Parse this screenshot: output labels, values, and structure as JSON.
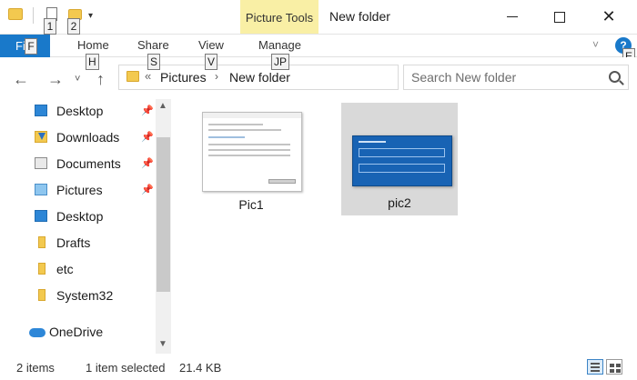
{
  "titlebar": {
    "context_tab": "Picture Tools",
    "title": "New folder",
    "qa_dropdown_icon": "chevron-down-icon",
    "buttons": {
      "minimize": "minimize-icon",
      "maximize": "maximize-icon",
      "close": "✕"
    }
  },
  "keytips": {
    "qa1": "1",
    "qa2": "2",
    "file": "F",
    "home": "H",
    "share": "S",
    "view": "V",
    "manage": "JP",
    "help": "E"
  },
  "ribbon": {
    "tabs": [
      {
        "label": "File"
      },
      {
        "label": "Home"
      },
      {
        "label": "Share"
      },
      {
        "label": "View"
      },
      {
        "label": "Manage"
      }
    ],
    "help": "?",
    "accent": "#1979ca"
  },
  "nav": {
    "back": "←",
    "forward": "→",
    "recent": "˅",
    "up": "↑",
    "address": {
      "overflow": "«",
      "crumbs": [
        "Pictures",
        "New folder"
      ],
      "separator": "›"
    },
    "refresh": "↻",
    "search_placeholder": "Search New folder"
  },
  "navpane": {
    "items": [
      {
        "label": "Desktop",
        "icon": "desktop-icon",
        "pinned": true
      },
      {
        "label": "Downloads",
        "icon": "downloads-icon",
        "pinned": true
      },
      {
        "label": "Documents",
        "icon": "documents-icon",
        "pinned": true
      },
      {
        "label": "Pictures",
        "icon": "pictures-icon",
        "pinned": true
      },
      {
        "label": "Desktop",
        "icon": "desktop-icon",
        "pinned": false
      },
      {
        "label": "Drafts",
        "icon": "folder-icon",
        "pinned": false
      },
      {
        "label": "etc",
        "icon": "folder-icon",
        "pinned": false
      },
      {
        "label": "System32",
        "icon": "folder-icon",
        "pinned": false
      },
      {
        "label": "OneDrive",
        "icon": "onedrive-cloud-icon",
        "pinned": false
      }
    ],
    "pin_glyph": "📌"
  },
  "files": [
    {
      "name": "Pic1",
      "selected": false
    },
    {
      "name": "pic2",
      "selected": true
    }
  ],
  "status": {
    "count": "2 items",
    "selected": "1 item selected",
    "size": "21.4 KB"
  }
}
